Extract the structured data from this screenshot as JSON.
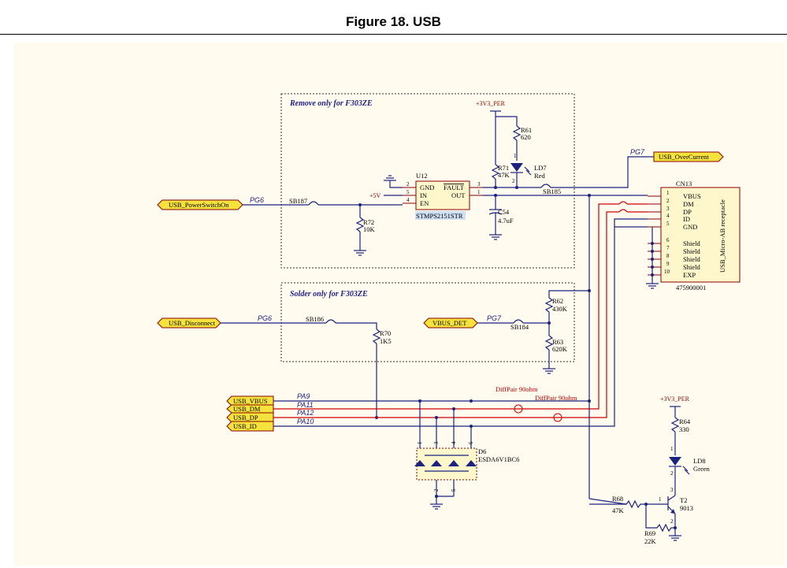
{
  "figure_title": "Figure 18. USB",
  "boxes": {
    "remove": "Remove only for F303ZE",
    "solder": "Solder only for F303ZE"
  },
  "connectors": {
    "power_switch": "USB_PowerSwitchOn",
    "overcurrent": "USB_OverCurrent",
    "disconnect": "USB_Disconnect",
    "vbus_det": "VBUS_DET",
    "usb_vbus": "USB_VBUS",
    "usb_dm": "USB_DM",
    "usb_dp": "USB_DP",
    "usb_id": "USB_ID"
  },
  "ports": {
    "pg6_a": "PG6",
    "pg7_a": "PG7",
    "pg6_b": "PG6",
    "pg7_b": "PG7",
    "pa9": "PA9",
    "pa11": "PA11",
    "pa12": "PA12",
    "pa10": "PA10"
  },
  "power": {
    "v33_a": "+3V3_PER",
    "v5": "+5V",
    "v33_b": "+3V3_PER"
  },
  "u12": {
    "ref": "U12",
    "part": "STMPS2151STR",
    "gnd": "GND",
    "in": "IN",
    "en": "EN",
    "fault": "FAULT",
    "out": "OUT",
    "p2": "2",
    "p5": "5",
    "p4": "4",
    "p3": "3",
    "p1": "1"
  },
  "cn13": {
    "ref": "CN13",
    "part": "475900001",
    "title": "USB_Micro-AB receptacle",
    "pins": [
      {
        "num": "1",
        "name": "VBUS"
      },
      {
        "num": "2",
        "name": "DM"
      },
      {
        "num": "3",
        "name": "DP"
      },
      {
        "num": "4",
        "name": "ID"
      },
      {
        "num": "5",
        "name": "GND"
      },
      {
        "num": "6",
        "name": "Shield"
      },
      {
        "num": "7",
        "name": "Shield"
      },
      {
        "num": "8",
        "name": "Shield"
      },
      {
        "num": "9",
        "name": "Shield"
      },
      {
        "num": "10",
        "name": "EXP"
      }
    ]
  },
  "components": {
    "r61": {
      "ref": "R61",
      "val": "620"
    },
    "r71": {
      "ref": "R71",
      "val": "47K"
    },
    "ld7": {
      "ref": "LD7",
      "val": "Red"
    },
    "r72": {
      "ref": "R72",
      "val": "10K"
    },
    "c54": {
      "ref": "C54",
      "val": "4.7uF"
    },
    "r62": {
      "ref": "R62",
      "val": "430K"
    },
    "r63": {
      "ref": "R63",
      "val": "620K"
    },
    "r70": {
      "ref": "R70",
      "val": "1K5"
    },
    "r64": {
      "ref": "R64",
      "val": "330"
    },
    "ld8": {
      "ref": "LD8",
      "val": "Green"
    },
    "r68": {
      "ref": "R68",
      "val": "47K"
    },
    "r69": {
      "ref": "R69",
      "val": "22K"
    },
    "t2": {
      "ref": "T2",
      "val": "9013"
    },
    "d6": {
      "ref": "D6",
      "val": "ESDA6V1BC6"
    }
  },
  "solder_bridges": {
    "sb187": "SB187",
    "sb185": "SB185",
    "sb186": "SB186",
    "sb184": "SB184"
  },
  "diffpair": {
    "a": "DiffPair 90ohm",
    "b": "DiffPair 90ohm"
  },
  "pin_numbers": {
    "d6": [
      "1",
      "3",
      "4",
      "6",
      "2",
      "5"
    ],
    "ld7": [
      "1",
      "2"
    ],
    "ld8": [
      "1",
      "2"
    ],
    "t2": [
      "1",
      "3",
      "2"
    ]
  }
}
